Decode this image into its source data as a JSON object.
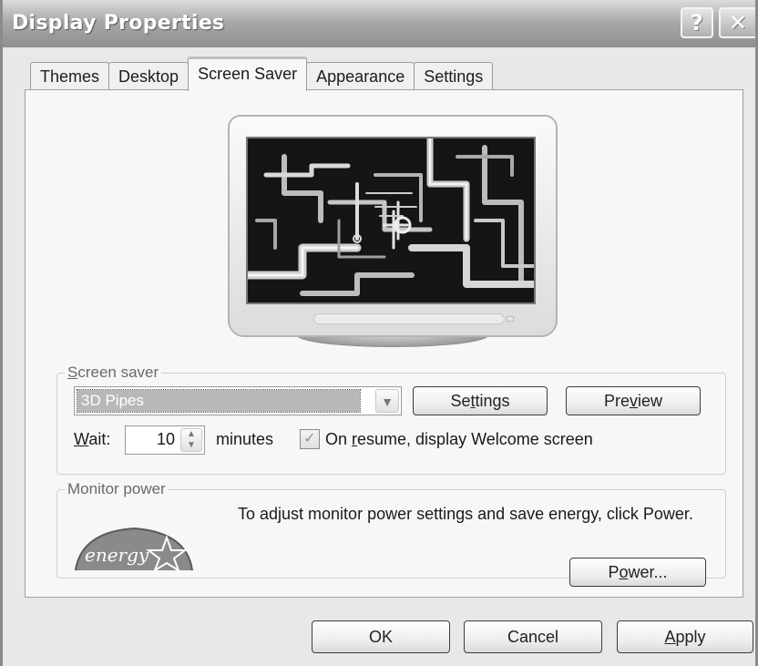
{
  "window": {
    "title": "Display Properties"
  },
  "titlebar": {
    "help_label": "?",
    "close_label": "✕"
  },
  "tabs": [
    {
      "label": "Themes"
    },
    {
      "label": "Desktop"
    },
    {
      "label": "Screen Saver"
    },
    {
      "label": "Appearance"
    },
    {
      "label": "Settings"
    }
  ],
  "active_tab": "Screen Saver",
  "screen_saver": {
    "group_label": "Screen saver",
    "selected": "3D Pipes",
    "settings_button": {
      "pre": "Se",
      "key": "t",
      "post": "tings"
    },
    "preview_button": {
      "pre": "Pre",
      "key": "v",
      "post": "iew"
    },
    "wait_label": {
      "key": "W",
      "post": "ait:"
    },
    "wait_value": "10",
    "minutes_label": "minutes",
    "resume_checked": true,
    "resume_label": {
      "pre": "On ",
      "key": "r",
      "post": "esume, display Welcome screen"
    }
  },
  "monitor_power": {
    "group_label": "Monitor power",
    "text": "To adjust monitor power settings and save energy, click Power.",
    "power_button": {
      "pre": "P",
      "key": "o",
      "post": "wer..."
    },
    "logo_text": "energy"
  },
  "footer": {
    "ok_label": "OK",
    "cancel_label": "Cancel",
    "apply_button": {
      "key": "A",
      "post": "pply"
    }
  },
  "colors": {
    "window_bg": "#e8e8e6",
    "panel_bg": "#f7f7f5",
    "selection_bg": "#b8b8b8"
  }
}
